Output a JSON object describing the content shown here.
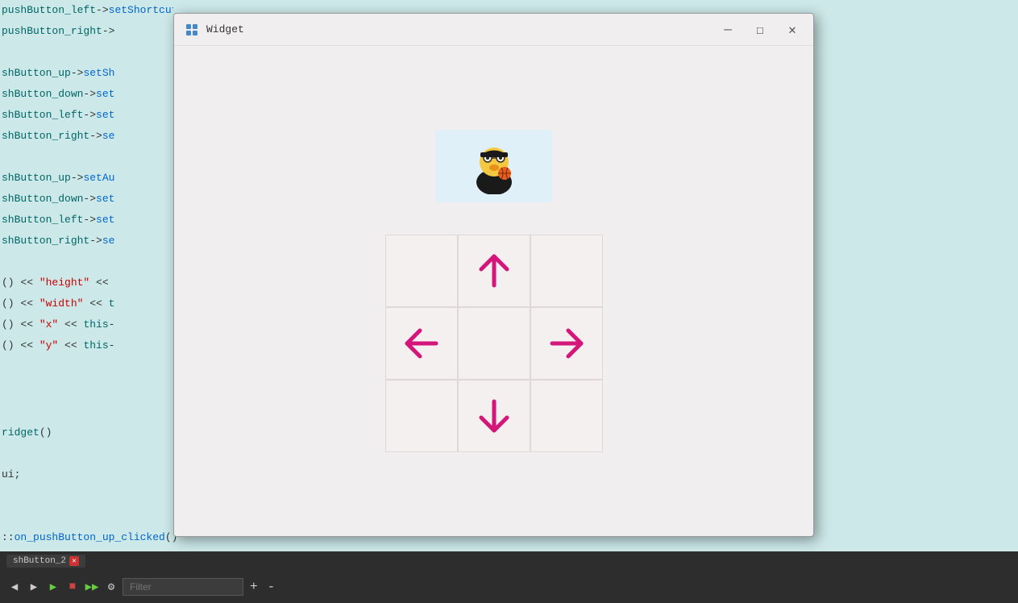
{
  "window": {
    "title": "Widget",
    "icon": "widget-icon"
  },
  "controls": {
    "minimize": "—",
    "maximize": "☐",
    "close": "✕"
  },
  "code": {
    "lines": [
      "pushButton_left->setShortcut(QKeySequence(\"a\"));",
      "pushButton_right->",
      "",
      "shButton_up->setSh",
      "shButton_down->set",
      "shButton_left->set",
      "shButton_right->se",
      "",
      "shButton_up->setAu",
      "shButton_down->set",
      "shButton_left->set",
      "shButton_right->se",
      "",
      "() << \"height\" <<",
      "() << \"width\" << t",
      "() << \"x\" << this-",
      "() << \"y\" << this-"
    ],
    "bottom_lines": [
      "ridget()",
      "",
      "ui;",
      "",
      "",
      "::on_pushButton_up_clicked()"
    ]
  },
  "toolbar": {
    "filter_placeholder": "Filter",
    "plus_label": "+",
    "minus_label": "-"
  },
  "tab": {
    "label": "shButton_2",
    "close_icon": "✕"
  },
  "directions": {
    "up_aria": "up arrow",
    "down_aria": "down arrow",
    "left_aria": "left arrow",
    "right_aria": "right arrow"
  },
  "arrow_color": "#d4167a"
}
